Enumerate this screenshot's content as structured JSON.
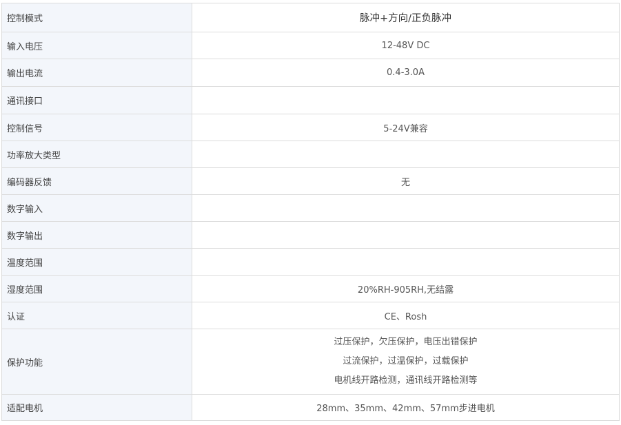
{
  "specs": [
    {
      "label": "控制模式",
      "value": "脉冲+方向/正负脉冲"
    },
    {
      "label": "输入电压",
      "value": "12-48V DC"
    },
    {
      "label": "输出电流",
      "value": "0.4-3.0A"
    },
    {
      "label": "通讯接口",
      "value": ""
    },
    {
      "label": "控制信号",
      "value": "5-24V兼容"
    },
    {
      "label": "功率放大类型",
      "value": ""
    },
    {
      "label": "编码器反馈",
      "value": "无"
    },
    {
      "label": "数字输入",
      "value": ""
    },
    {
      "label": "数字输出",
      "value": ""
    },
    {
      "label": "温度范围",
      "value": ""
    },
    {
      "label": "湿度范围",
      "value": "20%RH-905RH,无结露"
    },
    {
      "label": "认证",
      "value": "CE、Rosh"
    },
    {
      "label": "保护功能",
      "lines": [
        "过压保护，欠压保护，电压出错保护",
        "过流保护，过温保护，过载保护",
        "电机线开路检测，通讯线开路检测等"
      ]
    },
    {
      "label": "适配电机",
      "value": "28mm、35mm、42mm、57mm步进电机"
    }
  ]
}
